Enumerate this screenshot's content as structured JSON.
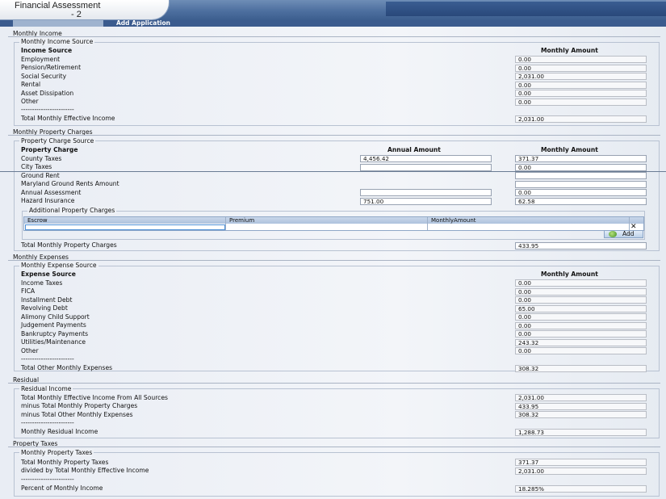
{
  "header": {
    "title_line1": "Financial Assessment",
    "title_line2": "- 2",
    "add_application": "Add Application"
  },
  "monthly_income": {
    "section": "Monthly Income",
    "panel": "Monthly Income Source",
    "col_source": "Income Source",
    "col_monthly": "Monthly Amount",
    "rows": [
      {
        "label": "Employment",
        "value": "0.00"
      },
      {
        "label": "Pension/Retirement",
        "value": "0.00"
      },
      {
        "label": "Social Security",
        "value": "2,031.00"
      },
      {
        "label": "Rental",
        "value": "0.00"
      },
      {
        "label": "Asset Dissipation",
        "value": "0.00"
      },
      {
        "label": "Other",
        "value": "0.00"
      }
    ],
    "divider": "------------------------",
    "total_label": "Total Monthly Effective Income",
    "total_value": "2,031.00"
  },
  "property_charges": {
    "section": "Monthly Property Charges",
    "panel": "Property Charge Source",
    "col_charge": "Property Charge",
    "col_annual": "Annual Amount",
    "col_monthly": "Monthly Amount",
    "rows": [
      {
        "label": "County Taxes",
        "annual": "4,456.42",
        "monthly": "371.37"
      },
      {
        "label": "City Taxes",
        "annual": "",
        "monthly": "0.00"
      },
      {
        "label": "Ground Rent",
        "monthly": ""
      },
      {
        "label": "Maryland Ground Rents Amount",
        "monthly": ""
      },
      {
        "label": "Annual Assessment",
        "annual": "",
        "monthly": "0.00"
      },
      {
        "label": "Hazard Insurance",
        "annual": "751.00",
        "monthly": "62.58"
      }
    ],
    "additional": {
      "legend": "Additional Property Charges",
      "columns": [
        "Escrow",
        "Premium",
        "MonthlyAmount"
      ],
      "add_label": "Add"
    },
    "total_label": "Total Monthly Property Charges",
    "total_value": "433.95"
  },
  "monthly_expenses": {
    "section": "Monthly Expenses",
    "panel": "Monthly Expense Source",
    "col_source": "Expense Source",
    "col_monthly": "Monthly Amount",
    "rows": [
      {
        "label": "Income Taxes",
        "value": "0.00"
      },
      {
        "label": "FICA",
        "value": "0.00"
      },
      {
        "label": "Installment Debt",
        "value": "0.00"
      },
      {
        "label": "Revolving Debt",
        "value": "65.00"
      },
      {
        "label": "Alimony Child Support",
        "value": "0.00"
      },
      {
        "label": "Judgement Payments",
        "value": "0.00"
      },
      {
        "label": "Bankruptcy Payments",
        "value": "0.00"
      },
      {
        "label": "Utilities/Maintenance",
        "value": "243.32"
      },
      {
        "label": "Other",
        "value": "0.00"
      }
    ],
    "divider": "------------------------",
    "total_label": "Total Other Monthly Expenses",
    "total_value": "308.32"
  },
  "residual": {
    "section": "Residual",
    "panel": "Residual Income",
    "rows": [
      {
        "label": "Total Monthly Effective Income From All Sources",
        "value": "2,031.00"
      },
      {
        "label": "minus Total Monthly Property Charges",
        "value": "433.95"
      },
      {
        "label": "minus Total Other Monthly Expenses",
        "value": "308.32"
      }
    ],
    "divider": "------------------------",
    "total_label": "Monthly Residual Income",
    "total_value": "1,288.73"
  },
  "property_taxes": {
    "section": "Property Taxes",
    "panel": "Monthly Property Taxes",
    "rows": [
      {
        "label": "Total Monthly Property Taxes",
        "value": "371.37"
      },
      {
        "label": "divided by Total Monthly Effective Income",
        "value": "2,031.00"
      }
    ],
    "divider": "------------------------",
    "total_label": "Percent of Monthly Income",
    "total_value": "18.285%"
  }
}
